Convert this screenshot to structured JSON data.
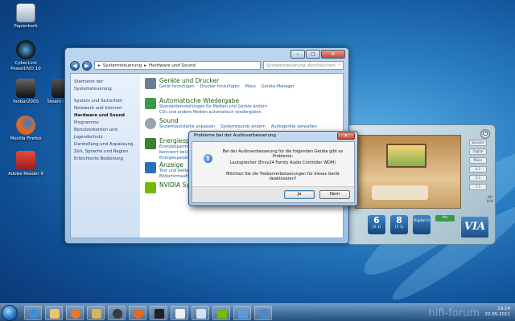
{
  "desktop_icons": [
    {
      "label": "Papierkorb",
      "icon": "recycle-bin-icon",
      "color": "#c9d6de"
    },
    {
      "label": "CyberLink PowerDVD 10",
      "icon": "powerdvd-icon",
      "color": "#2a2a2a"
    },
    {
      "label": "foobar2000",
      "icon": "foobar-icon",
      "color": "#333333"
    },
    {
      "label": "Mozilla Firefox",
      "icon": "firefox-icon",
      "color": "#e66a1d"
    },
    {
      "label": "Adobe Reader 9",
      "icon": "adobe-reader-icon",
      "color": "#c62828"
    },
    {
      "label": "Steam - Ve...",
      "icon": "steam-icon",
      "color": "#333333"
    }
  ],
  "explorer": {
    "breadcrumb": [
      "Systemsteuerung",
      "Hardware und Sound"
    ],
    "search_placeholder": "Systemsteuerung durchsuchen",
    "sidebar": [
      "Startseite der Systemsteuerung",
      "System und Sicherheit",
      "Netzwerk und Internet",
      "Hardware und Sound",
      "Programme",
      "Benutzerkonten und Jugendschutz",
      "Darstellung und Anpassung",
      "Zeit, Sprache und Region",
      "Erleichterte Bedienung"
    ],
    "categories": [
      {
        "title": "Geräte und Drucker",
        "icon_color": "#6b7f93",
        "links": [
          "Gerät hinzufügen",
          "Drucker hinzufügen",
          "Maus",
          "Geräte-Manager"
        ]
      },
      {
        "title": "Automatische Wiedergabe",
        "icon_color": "#3b9a4a",
        "links": [
          "Standardeinstellungen für Medien und Geräte ändern",
          "CDs und andere Medien automatisch wiedergeben"
        ]
      },
      {
        "title": "Sound",
        "icon_color": "#9aa3ab",
        "links": [
          "Systemlautstärke anpassen",
          "Systemsounds ändern",
          "Audiogeräte verwalten"
        ]
      },
      {
        "title": "Energieoptionen",
        "icon_color": "#3d7f2d",
        "links": [
          "Energiesparmodus ändern",
          "Kennwort bei Reaktivierung anfordern",
          "Energiesparplan auswählen"
        ]
      },
      {
        "title": "Anzeige",
        "icon_color": "#2a6fb8",
        "links": [
          "Text und weitere Elemente vergrößern",
          "Bildschirmauflösung anpassen"
        ]
      },
      {
        "title": "NVIDIA Systemsteuerung",
        "icon_color": "#76b900",
        "links": []
      }
    ]
  },
  "dialog": {
    "title": "Probleme bei der Audioverbesserung",
    "line1": "Bei der Audioverbesserung für die folgenden Geräte gibt es Probleme:",
    "line2": "Lautsprecher (Envy24 Family Audio Controller WDM)",
    "line3": "Möchten Sie die Treiberverbesserungen für dieses Gerät deaktivieren?",
    "yes": "Ja",
    "no": "Nein"
  },
  "audio_panel": {
    "side_buttons": [
      "Speaker",
      "Digital",
      "Mixer",
      "4.1",
      "5.1",
      "7.1"
    ],
    "channels": [
      {
        "big": "6",
        "small": "(5.1)"
      },
      {
        "big": "8",
        "small": "(7.1)"
      }
    ],
    "digital_label": "Digital In",
    "yes_label": "Yes",
    "brand": "VIA",
    "rate": "48 kHz"
  },
  "taskbar": {
    "time": "19:14",
    "date": "22.05.2011",
    "watermark": "hifi-forum"
  }
}
